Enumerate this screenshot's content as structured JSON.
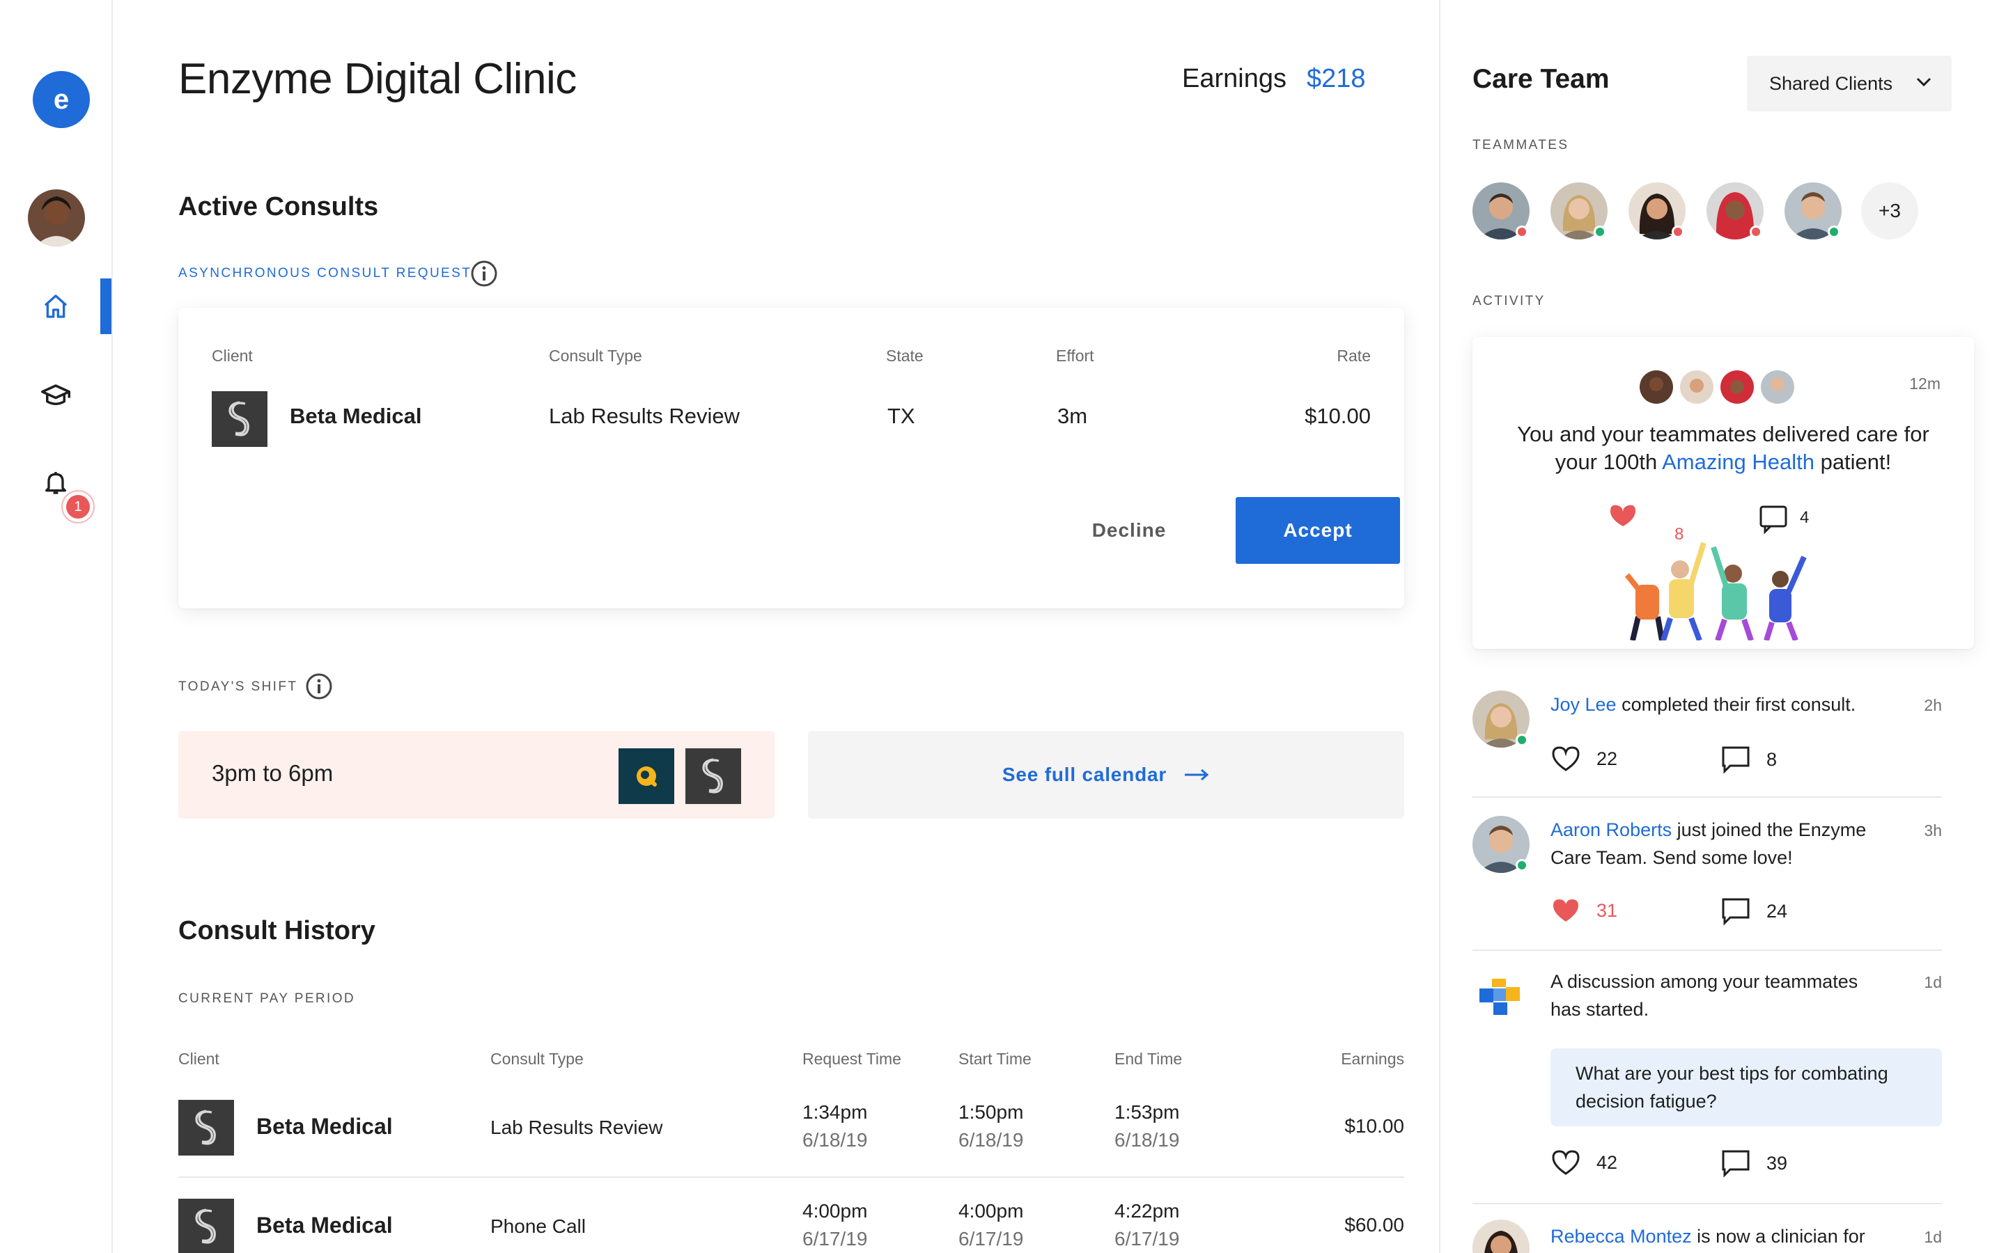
{
  "nav": {
    "logo_letter": "e",
    "notification_count": "1",
    "items": [
      {
        "name": "home",
        "icon": "home-icon"
      },
      {
        "name": "learning",
        "icon": "graduation-cap-icon"
      },
      {
        "name": "notifications",
        "icon": "bell-icon"
      }
    ]
  },
  "header": {
    "title": "Enzyme Digital Clinic",
    "earnings_label": "Earnings",
    "earnings_value": "$218"
  },
  "active_consults": {
    "title": "Active Consults",
    "subtitle": "ASYNCHRONOUS CONSULT REQUEST",
    "columns": [
      "Client",
      "Consult Type",
      "State",
      "Effort",
      "Rate"
    ],
    "request": {
      "client": "Beta Medical",
      "consult_type": "Lab Results Review",
      "state": "TX",
      "effort": "3m",
      "rate": "$10.00"
    },
    "decline_label": "Decline",
    "accept_label": "Accept"
  },
  "shift": {
    "label": "TODAY'S SHIFT",
    "time": "3pm to 6pm",
    "calendar_link": "See full calendar"
  },
  "history": {
    "title": "Consult History",
    "period": "CURRENT PAY PERIOD",
    "columns": [
      "Client",
      "Consult Type",
      "Request Time",
      "Start Time",
      "End Time",
      "Earnings"
    ],
    "rows": [
      {
        "client": "Beta Medical",
        "type": "Lab Results Review",
        "req_time": "1:34pm",
        "req_date": "6/18/19",
        "start_time": "1:50pm",
        "start_date": "6/18/19",
        "end_time": "1:53pm",
        "end_date": "6/18/19",
        "earnings": "$10.00"
      },
      {
        "client": "Beta Medical",
        "type": "Phone Call",
        "req_time": "4:00pm",
        "req_date": "6/17/19",
        "start_time": "4:00pm",
        "start_date": "6/17/19",
        "end_time": "4:22pm",
        "end_date": "6/17/19",
        "earnings": "$60.00"
      }
    ]
  },
  "care_team": {
    "title": "Care Team",
    "filter": "Shared Clients",
    "teammates_label": "TEAMMATES",
    "teammates_more": "+3",
    "activity_label": "ACTIVITY",
    "milestone": {
      "time": "12m",
      "text_before": "You and your teammates delivered care for your 100th",
      "highlight": "Amazing Health",
      "text_after": "patient!",
      "likes": "8",
      "comments": "4"
    },
    "feed": [
      {
        "name": "Joy Lee",
        "text": "completed their first consult.",
        "time": "2h",
        "likes": "22",
        "comments": "8"
      },
      {
        "name": "Aaron Roberts",
        "text": "just joined the Enzyme Care Team. Send some love!",
        "time": "3h",
        "likes": "31",
        "comments": "24"
      },
      {
        "text": "A discussion among your teammates has started.",
        "time": "1d",
        "quote": "What are your best tips for combating decision fatigue?",
        "likes": "42",
        "comments": "39"
      },
      {
        "name": "Rebecca Montez",
        "text": "is now a clinician for",
        "time": "1d"
      }
    ]
  },
  "colors": {
    "accent": "#1f6bd8",
    "online": "#1fae6e",
    "away": "#e85858",
    "shift_bg": "#fdf0ed"
  }
}
